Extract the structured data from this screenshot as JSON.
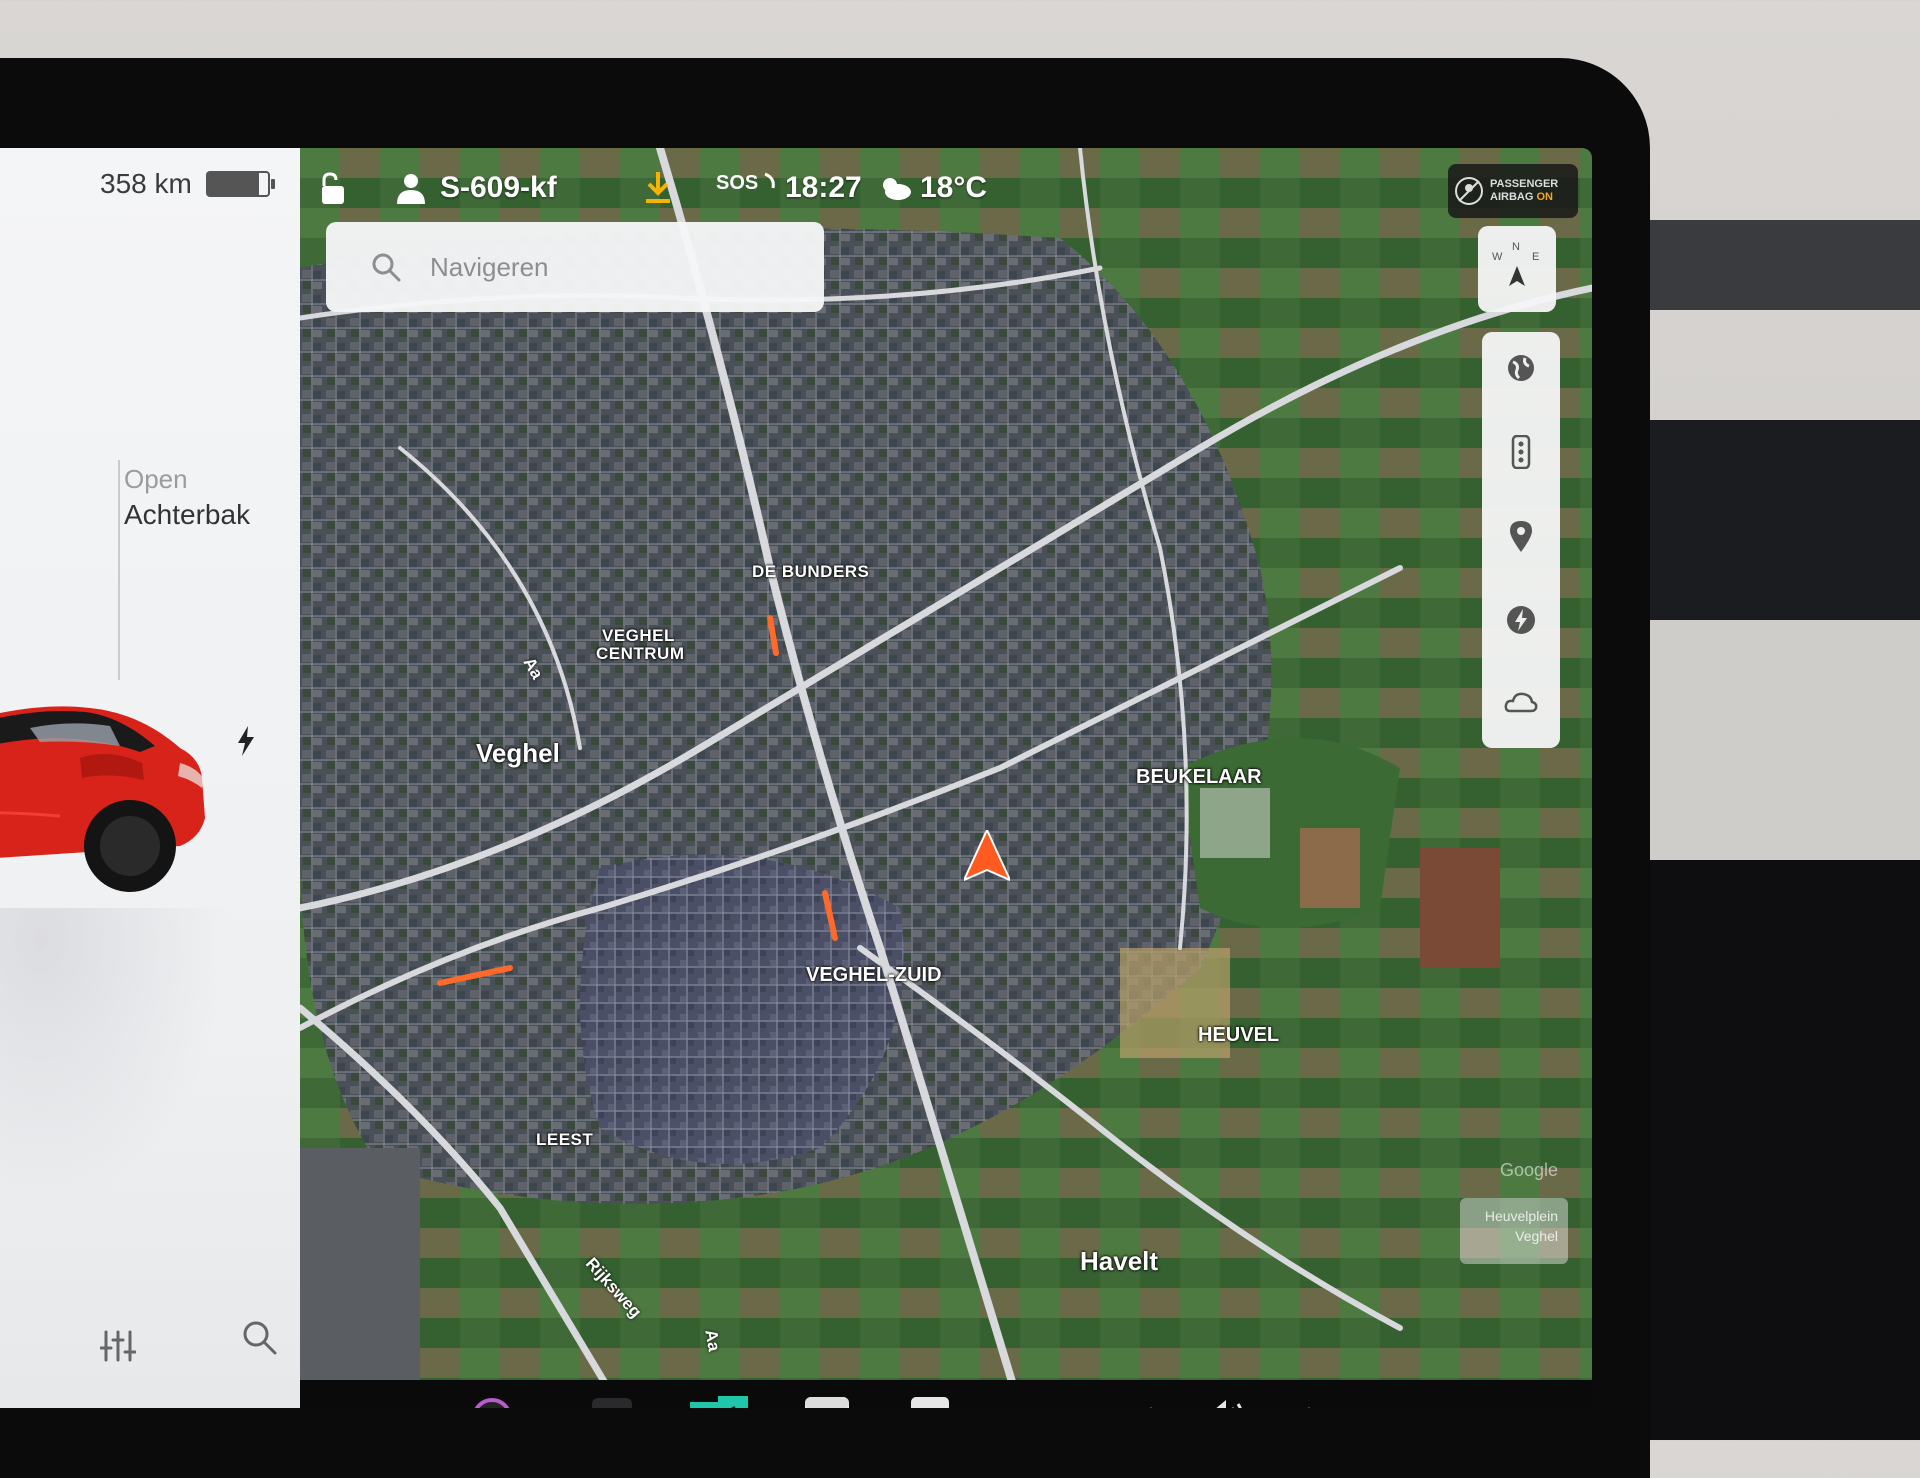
{
  "car_panel": {
    "range": "358 km",
    "battery_level": 0.85,
    "trunk_status": "Open",
    "trunk_name": "Achterbak"
  },
  "status_bar": {
    "profile_name": "S-609-kf",
    "sos_label": "SOS",
    "time": "18:27",
    "temperature": "18°C",
    "airbag_line1": "PASSENGER",
    "airbag_line2": "AIRBAG",
    "airbag_state": "ON"
  },
  "search": {
    "placeholder": "Navigeren"
  },
  "map": {
    "places": {
      "de_bunders": "DE BUNDERS",
      "veghel_centrum_1": "VEGHEL",
      "veghel_centrum_2": "CENTRUM",
      "veghel": "Veghel",
      "beukelaar": "BEUKELAAR",
      "veghel_zuid": "VEGHEL-ZUID",
      "heuvel": "HEUVEL",
      "leest": "LEEST",
      "havelt": "Havelt",
      "aa_1": "Aa",
      "aa_2": "Aa",
      "rijksweg": "Rijksweg"
    },
    "attribution": "Google",
    "mini_card_line1": "Heuvelplein",
    "mini_card_line2": "Veghel"
  },
  "colors": {
    "nav_arrow": "#ff5a1f",
    "car_body": "#d8231a",
    "download_icon": "#f5b400",
    "app_teal": "#1fc7a8"
  },
  "icons": [
    "lock-icon",
    "profile-icon",
    "download-icon",
    "sos-icon",
    "weather-icon",
    "airbag-icon",
    "search-icon",
    "compass-icon",
    "globe-icon",
    "traffic-icon",
    "pin-icon",
    "charger-icon",
    "weather-overlay-icon",
    "controls-icon",
    "charge-icon",
    "volume-icon"
  ]
}
